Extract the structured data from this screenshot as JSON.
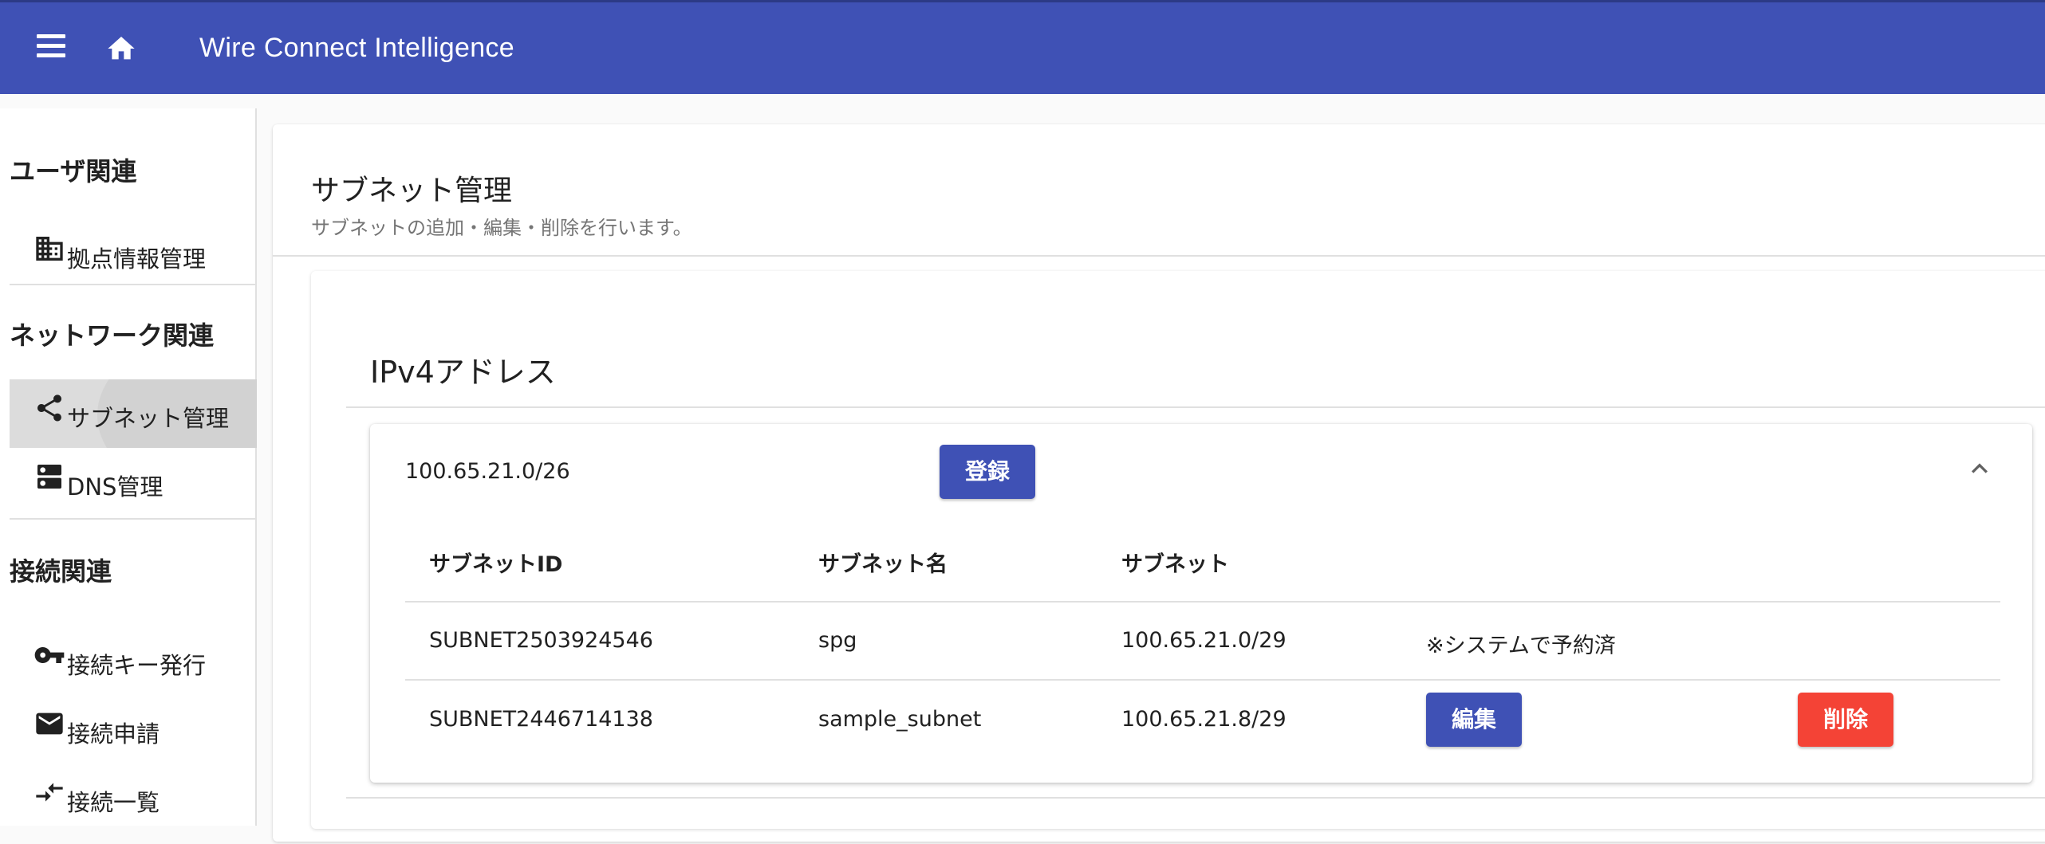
{
  "app": {
    "title": "Wire Connect Intelligence"
  },
  "sidebar": {
    "sections": [
      {
        "heading": "ユーザ関連"
      },
      {
        "heading": "ネットワーク関連"
      },
      {
        "heading": "接続関連"
      }
    ],
    "items": [
      {
        "label": "拠点情報管理",
        "icon": "building-icon"
      },
      {
        "label": "サブネット管理",
        "icon": "share-icon",
        "active": true
      },
      {
        "label": "DNS管理",
        "icon": "dns-icon"
      },
      {
        "label": "接続キー発行",
        "icon": "key-icon"
      },
      {
        "label": "接続申請",
        "icon": "mail-icon"
      },
      {
        "label": "接続一覧",
        "icon": "compare-arrows-icon"
      }
    ]
  },
  "page": {
    "title": "サブネット管理",
    "subtitle": "サブネットの追加・編集・削除を行います。"
  },
  "section": {
    "title": "IPv4アドレス"
  },
  "panel": {
    "range": "100.65.21.0/26",
    "register_label": "登録",
    "columns": [
      "サブネットID",
      "サブネット名",
      "サブネット"
    ],
    "rows": [
      {
        "id": "SUBNET2503924546",
        "name": "spg",
        "subnet": "100.65.21.0/29",
        "note": "※システムで予約済"
      },
      {
        "id": "SUBNET2446714138",
        "name": "sample_subnet",
        "subnet": "100.65.21.8/29",
        "edit_label": "編集",
        "delete_label": "削除"
      }
    ]
  },
  "colors": {
    "primary": "#3f51b5",
    "danger": "#f44336"
  }
}
